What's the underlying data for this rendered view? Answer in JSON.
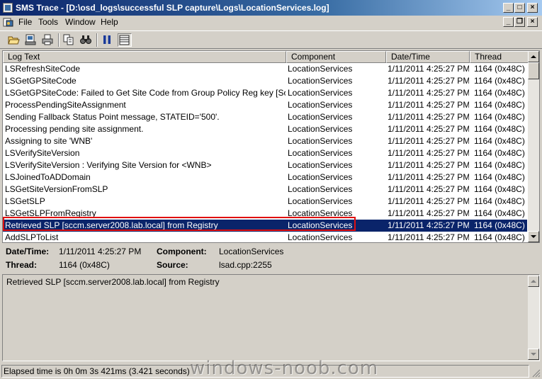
{
  "window": {
    "title": "SMS Trace - [D:\\osd_logs\\successful SLP capture\\Logs\\LocationServices.log]",
    "controls": {
      "minimize": "_",
      "maximize": "□",
      "close": "×"
    },
    "mdi_controls": {
      "minimize": "_",
      "restore": "❐",
      "close": "×"
    }
  },
  "menu": [
    {
      "label": "File"
    },
    {
      "label": "Tools"
    },
    {
      "label": "Window"
    },
    {
      "label": "Help"
    }
  ],
  "toolbar": {
    "buttons": [
      "open-icon",
      "print-preview-icon",
      "print-icon",
      "copy-icon",
      "find-icon",
      "pause-icon",
      "columns-icon"
    ]
  },
  "log": {
    "columns": [
      "Log Text",
      "Component",
      "Date/Time",
      "Thread"
    ],
    "rows": [
      {
        "text": "LSRefreshSiteCode",
        "component": "LocationServices",
        "datetime": "1/11/2011 4:25:27 PM",
        "thread": "1164 (0x48C)"
      },
      {
        "text": "LSGetGPSiteCode",
        "component": "LocationServices",
        "datetime": "1/11/2011 4:25:27 PM",
        "thread": "1164 (0x48C)"
      },
      {
        "text": "LSGetGPSiteCode: Failed to Get Site Code from Group Policy Reg key [Software\\M",
        "component": "LocationServices",
        "datetime": "1/11/2011 4:25:27 PM",
        "thread": "1164 (0x48C)"
      },
      {
        "text": "ProcessPendingSiteAssignment",
        "component": "LocationServices",
        "datetime": "1/11/2011 4:25:27 PM",
        "thread": "1164 (0x48C)"
      },
      {
        "text": "Sending Fallback Status Point message, STATEID='500'.",
        "component": "LocationServices",
        "datetime": "1/11/2011 4:25:27 PM",
        "thread": "1164 (0x48C)"
      },
      {
        "text": "Processing pending site assignment.",
        "component": "LocationServices",
        "datetime": "1/11/2011 4:25:27 PM",
        "thread": "1164 (0x48C)"
      },
      {
        "text": "Assigning to site 'WNB'",
        "component": "LocationServices",
        "datetime": "1/11/2011 4:25:27 PM",
        "thread": "1164 (0x48C)"
      },
      {
        "text": "LSVerifySiteVersion",
        "component": "LocationServices",
        "datetime": "1/11/2011 4:25:27 PM",
        "thread": "1164 (0x48C)"
      },
      {
        "text": "LSVerifySiteVersion : Verifying Site Version for <WNB>",
        "component": "LocationServices",
        "datetime": "1/11/2011 4:25:27 PM",
        "thread": "1164 (0x48C)"
      },
      {
        "text": "LSJoinedToADDomain",
        "component": "LocationServices",
        "datetime": "1/11/2011 4:25:27 PM",
        "thread": "1164 (0x48C)"
      },
      {
        "text": "LSGetSiteVersionFromSLP",
        "component": "LocationServices",
        "datetime": "1/11/2011 4:25:27 PM",
        "thread": "1164 (0x48C)"
      },
      {
        "text": "LSGetSLP",
        "component": "LocationServices",
        "datetime": "1/11/2011 4:25:27 PM",
        "thread": "1164 (0x48C)"
      },
      {
        "text": "LSGetSLPFromRegistry",
        "component": "LocationServices",
        "datetime": "1/11/2011 4:25:27 PM",
        "thread": "1164 (0x48C)"
      },
      {
        "text": "Retrieved SLP [sccm.server2008.lab.local] from Registry",
        "component": "LocationServices",
        "datetime": "1/11/2011 4:25:27 PM",
        "thread": "1164 (0x48C)",
        "selected": true
      },
      {
        "text": "AddSLPToList",
        "component": "LocationServices",
        "datetime": "1/11/2011 4:25:27 PM",
        "thread": "1164 (0x48C)"
      }
    ]
  },
  "details": {
    "datetime_label": "Date/Time:",
    "datetime_value": "1/11/2011 4:25:27 PM",
    "component_label": "Component:",
    "component_value": "LocationServices",
    "thread_label": "Thread:",
    "thread_value": "1164 (0x48C)",
    "source_label": "Source:",
    "source_value": "lsad.cpp:2255"
  },
  "message": "Retrieved SLP [sccm.server2008.lab.local] from Registry",
  "status": "Elapsed time is 0h 0m 3s 421ms (3.421 seconds)",
  "watermark": "windows-noob.com"
}
